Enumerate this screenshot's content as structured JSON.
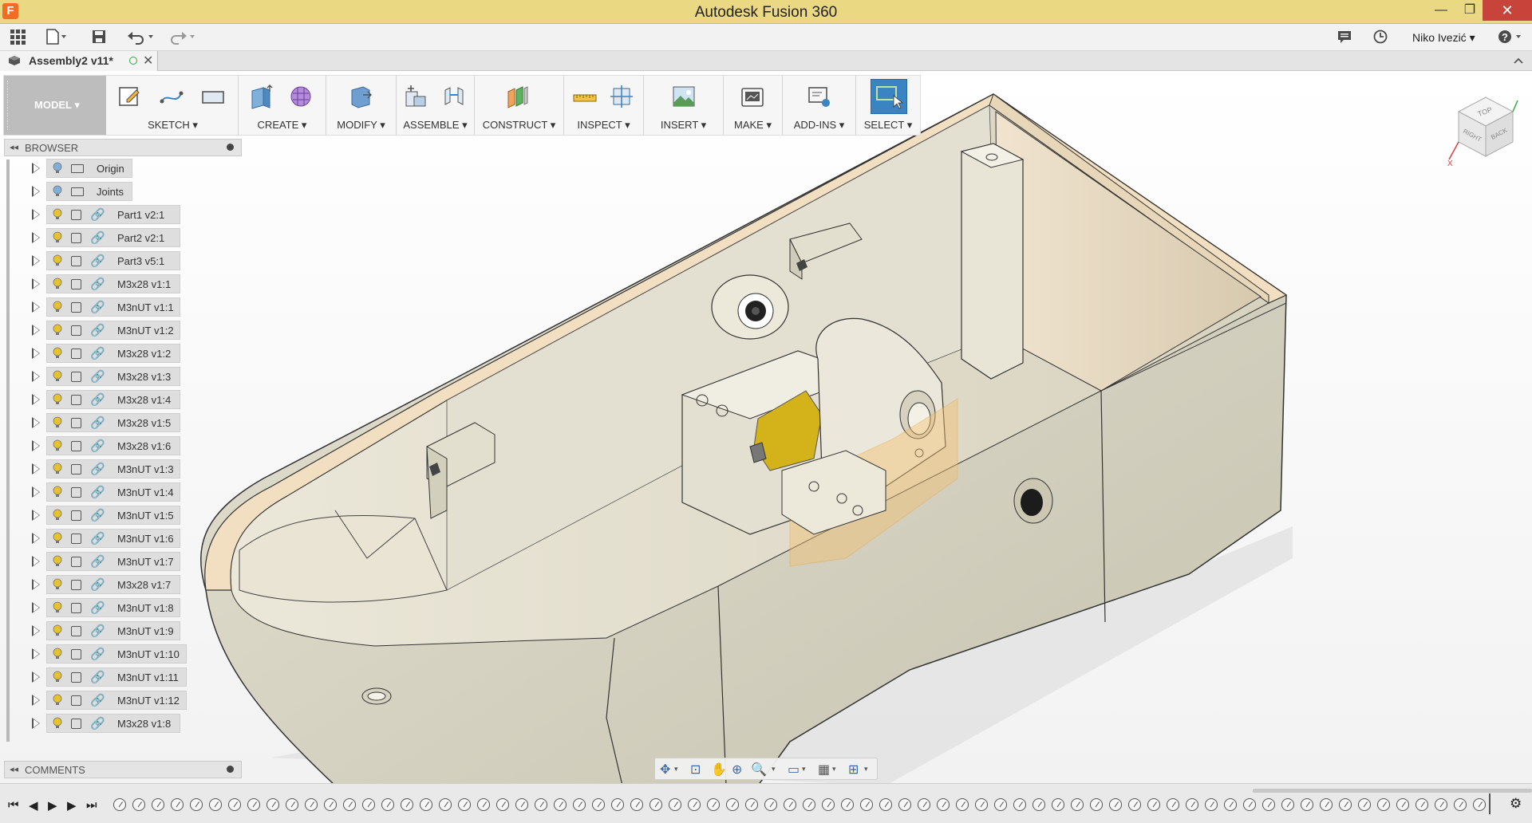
{
  "window": {
    "title": "Autodesk Fusion 360",
    "minimize": "—",
    "maximize": "❐",
    "close": "✕"
  },
  "quickbar": {
    "user": "Niko Ivezić ▾"
  },
  "document": {
    "tab_title": "Assembly2 v11*"
  },
  "toolbar": {
    "workspace": "MODEL ▾",
    "groups": [
      {
        "label": "SKETCH ▾"
      },
      {
        "label": "CREATE ▾"
      },
      {
        "label": "MODIFY ▾"
      },
      {
        "label": "ASSEMBLE ▾"
      },
      {
        "label": "CONSTRUCT ▾"
      },
      {
        "label": "INSPECT ▾"
      },
      {
        "label": "INSERT ▾"
      },
      {
        "label": "MAKE ▾"
      },
      {
        "label": "ADD-INS ▾"
      },
      {
        "label": "SELECT ▾"
      }
    ]
  },
  "browser": {
    "title": "BROWSER",
    "items": [
      {
        "label": "Origin",
        "type": "folder"
      },
      {
        "label": "Joints",
        "type": "folder"
      },
      {
        "label": "Part1 v2:1",
        "type": "component"
      },
      {
        "label": "Part2 v2:1",
        "type": "component"
      },
      {
        "label": "Part3 v5:1",
        "type": "component"
      },
      {
        "label": "M3x28 v1:1",
        "type": "component"
      },
      {
        "label": "M3nUT v1:1",
        "type": "component"
      },
      {
        "label": "M3nUT v1:2",
        "type": "component"
      },
      {
        "label": "M3x28 v1:2",
        "type": "component"
      },
      {
        "label": "M3x28 v1:3",
        "type": "component"
      },
      {
        "label": "M3x28 v1:4",
        "type": "component"
      },
      {
        "label": "M3x28 v1:5",
        "type": "component"
      },
      {
        "label": "M3x28 v1:6",
        "type": "component"
      },
      {
        "label": "M3nUT v1:3",
        "type": "component"
      },
      {
        "label": "M3nUT v1:4",
        "type": "component"
      },
      {
        "label": "M3nUT v1:5",
        "type": "component"
      },
      {
        "label": "M3nUT v1:6",
        "type": "component"
      },
      {
        "label": "M3nUT v1:7",
        "type": "component"
      },
      {
        "label": "M3x28 v1:7",
        "type": "component"
      },
      {
        "label": "M3nUT v1:8",
        "type": "component"
      },
      {
        "label": "M3nUT v1:9",
        "type": "component"
      },
      {
        "label": "M3nUT v1:10",
        "type": "component"
      },
      {
        "label": "M3nUT v1:11",
        "type": "component"
      },
      {
        "label": "M3nUT v1:12",
        "type": "component"
      },
      {
        "label": "M3x28 v1:8",
        "type": "component"
      }
    ]
  },
  "comments": {
    "title": "COMMENTS"
  },
  "viewcube": {
    "top": "TOP",
    "right": "RIGHT",
    "back": "BACK",
    "axis": "X"
  },
  "colors": {
    "titlebar": "#ead882",
    "select_accent": "#3a84c4",
    "model_body": "#dedbcc",
    "motor": "#d4b21a",
    "transparent_part": "#f3c072"
  }
}
